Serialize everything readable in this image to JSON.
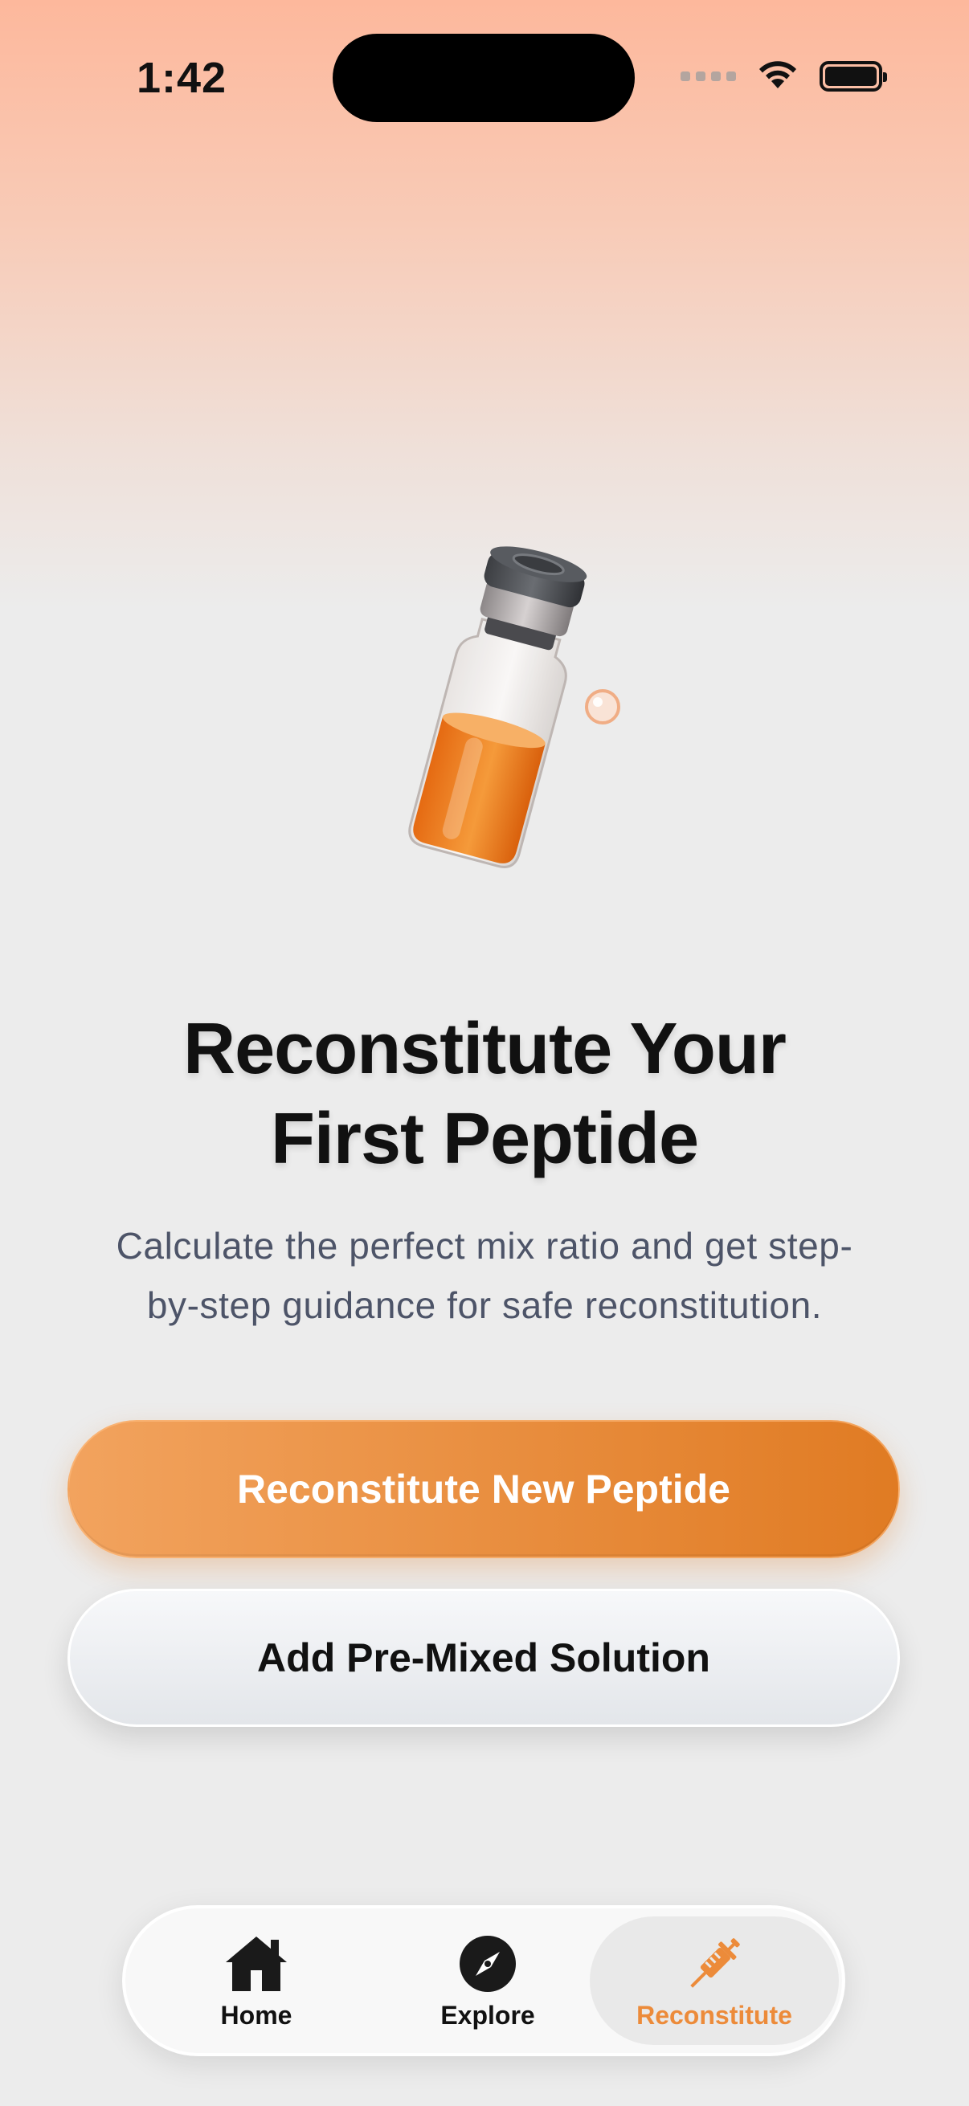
{
  "status_bar": {
    "time": "1:42"
  },
  "hero": {
    "icon": "vial-icon"
  },
  "content": {
    "title_line1": "Reconstitute Your",
    "title_line2": "First Peptide",
    "subtitle_line1": "Calculate the perfect mix ratio and get step-",
    "subtitle_line2": "by-step guidance for safe reconstitution."
  },
  "actions": {
    "primary_label": "Reconstitute New Peptide",
    "secondary_label": "Add Pre-Mixed Solution"
  },
  "tab_bar": {
    "items": [
      {
        "label": "Home",
        "icon": "home-icon"
      },
      {
        "label": "Explore",
        "icon": "compass-icon"
      },
      {
        "label": "Reconstitute",
        "icon": "syringe-icon",
        "selected": true
      }
    ]
  },
  "colors": {
    "accent": "#ec8b3a",
    "primary_gradient_start": "#f2a35e",
    "primary_gradient_end": "#e07b23",
    "header_gradient_top": "#fdb89c"
  }
}
